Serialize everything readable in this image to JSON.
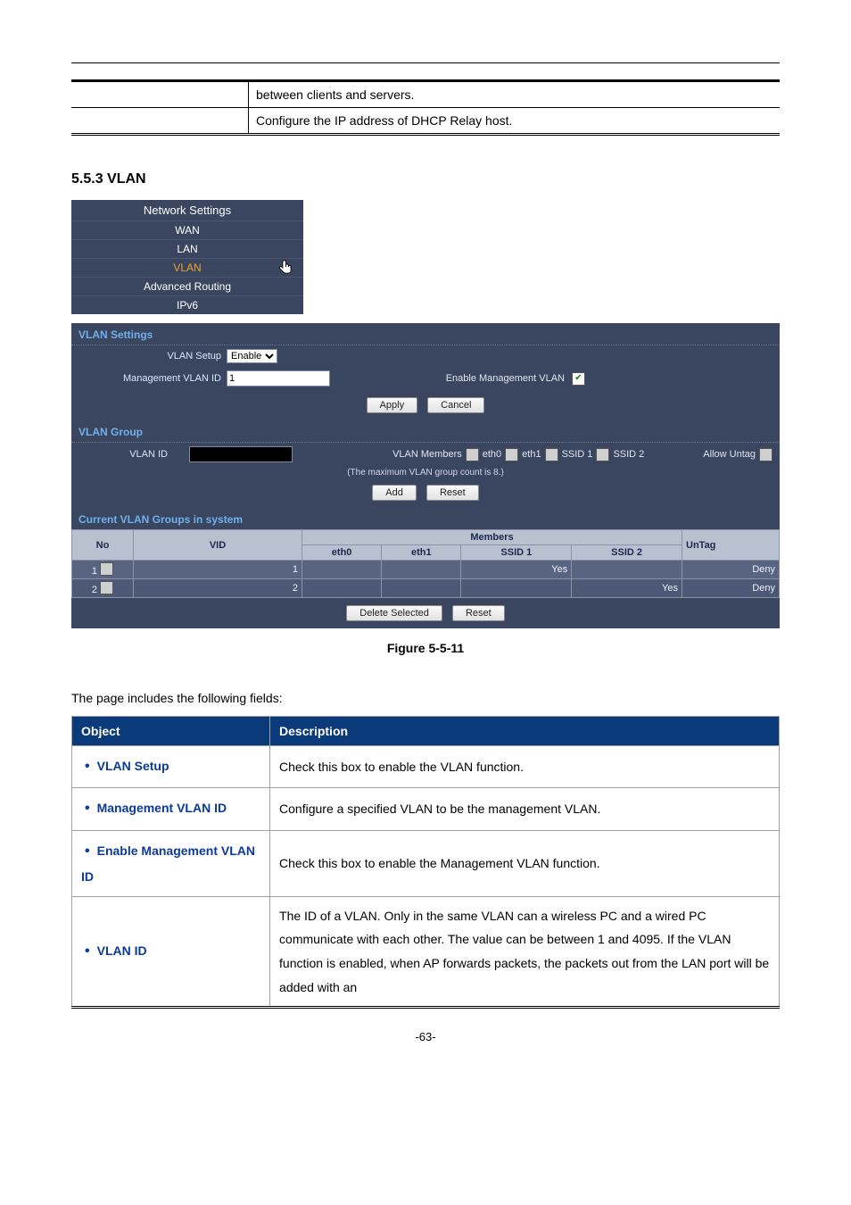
{
  "top_table": {
    "row1": "between clients and servers.",
    "row2": "Configure the IP address of DHCP Relay host."
  },
  "section": "5.5.3  VLAN",
  "nav": {
    "title": "Network Settings",
    "items": [
      "WAN",
      "LAN",
      "VLAN",
      "Advanced Routing",
      "IPv6"
    ],
    "active_index": 2
  },
  "vlan_settings": {
    "title": "VLAN Settings",
    "setup_label": "VLAN Setup",
    "setup_value": "Enable",
    "mgmt_id_label": "Management VLAN ID",
    "mgmt_id_value": "1",
    "enable_mgmt_label": "Enable Management VLAN",
    "enable_mgmt_checked": true,
    "apply": "Apply",
    "cancel": "Cancel"
  },
  "vlan_group": {
    "title": "VLAN Group",
    "vlan_id_label": "VLAN ID",
    "members_label": "VLAN Members",
    "members": [
      "eth0",
      "eth1",
      "SSID 1",
      "SSID 2"
    ],
    "allow_untag_label": "Allow Untag",
    "hint": "(The maximum VLAN group count is 8.)",
    "add": "Add",
    "reset": "Reset"
  },
  "current_groups": {
    "title": "Current VLAN Groups in system",
    "headers": {
      "no": "No",
      "vid": "VID",
      "members": "Members",
      "untag": "UnTag",
      "eth0": "eth0",
      "eth1": "eth1",
      "ssid1": "SSID 1",
      "ssid2": "SSID 2"
    },
    "rows": [
      {
        "no": "1",
        "vid": "1",
        "eth0": "",
        "eth1": "",
        "ssid1": "Yes",
        "ssid2": "",
        "untag": "Deny"
      },
      {
        "no": "2",
        "vid": "2",
        "eth0": "",
        "eth1": "",
        "ssid1": "",
        "ssid2": "Yes",
        "untag": "Deny"
      }
    ],
    "delete_selected": "Delete Selected",
    "reset": "Reset"
  },
  "figure_caption": "Figure 5-5-11",
  "intro": "The page includes the following fields:",
  "desc_table": {
    "headers": {
      "object": "Object",
      "description": "Description"
    },
    "rows": [
      {
        "object": "VLAN Setup",
        "description": "Check this box to enable the VLAN function."
      },
      {
        "object": "Management VLAN ID",
        "description": "Configure a specified VLAN to be the management VLAN."
      },
      {
        "object": "Enable Management VLAN ID",
        "description": "Check this box to enable the Management VLAN function."
      },
      {
        "object": "VLAN ID",
        "description": "The ID of a VLAN. Only in the same VLAN can a wireless PC and a wired PC communicate with each other. The value can be between 1 and 4095. If the VLAN function is enabled, when AP forwards packets, the packets out from the LAN port will be added with an"
      }
    ]
  },
  "page_number": "-63-"
}
